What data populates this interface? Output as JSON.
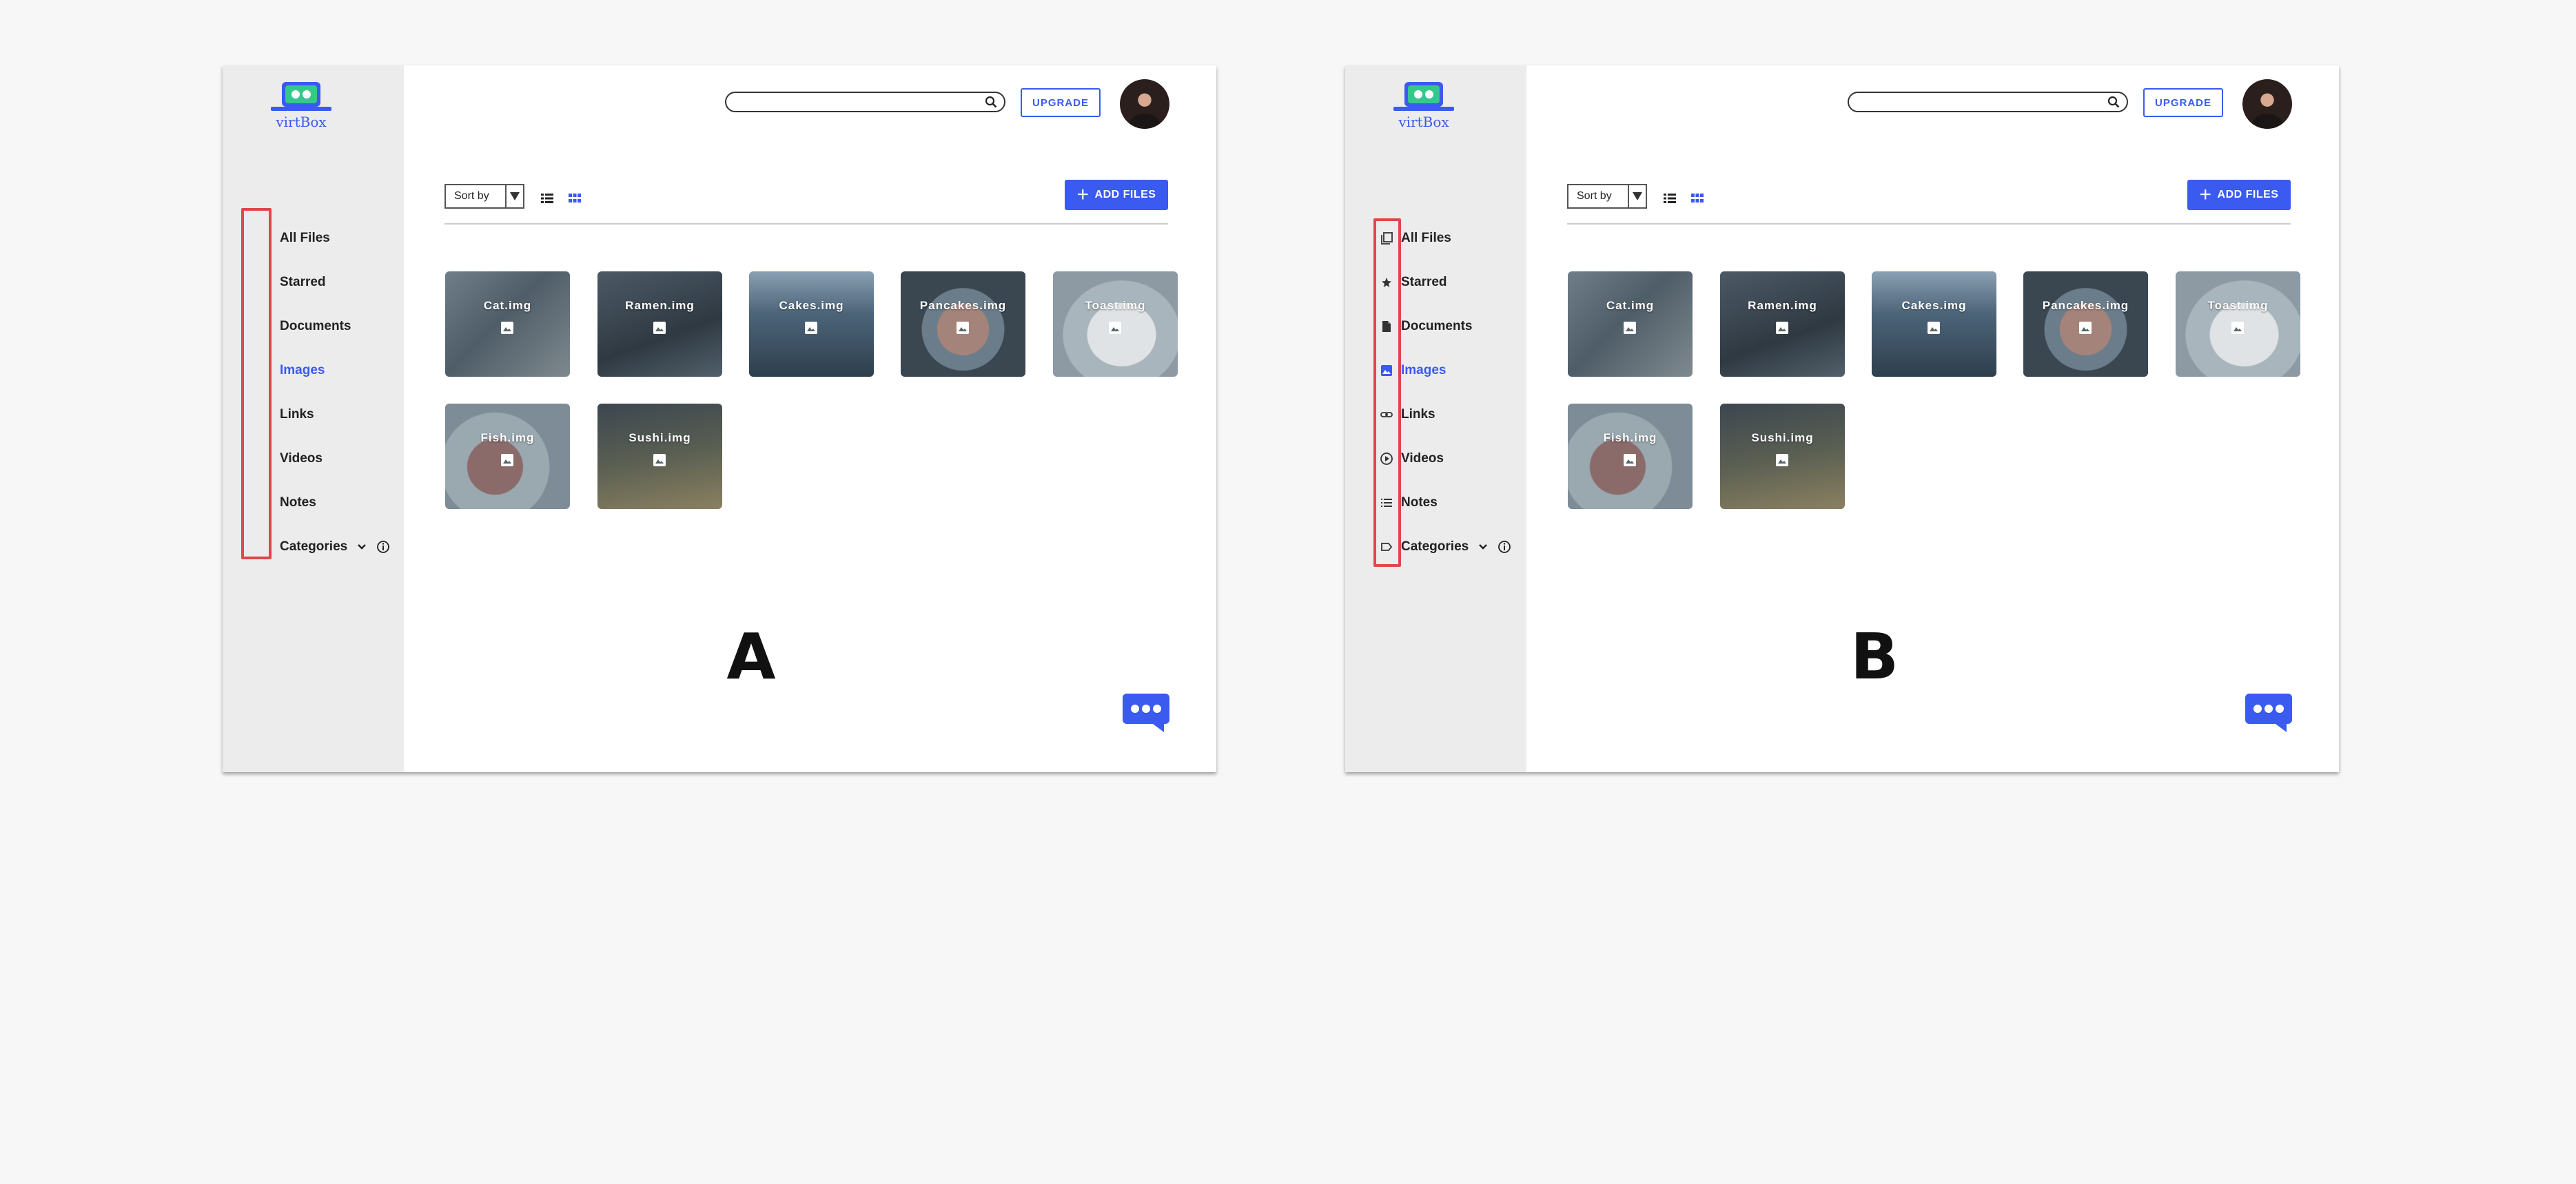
{
  "brand": {
    "name": "virtBox"
  },
  "colors": {
    "accent": "#3a5af0",
    "highlight": "#e0474c",
    "sidebar": "#ececec"
  },
  "search": {
    "placeholder": "",
    "value": ""
  },
  "upgrade_label": "UPGRADE",
  "sort_label": "Sort by",
  "add_files_label": "ADD FILES",
  "nav": {
    "items": [
      {
        "label": "All Files",
        "icon": "copy-icon"
      },
      {
        "label": "Starred",
        "icon": "star-icon"
      },
      {
        "label": "Documents",
        "icon": "document-icon"
      },
      {
        "label": "Images",
        "icon": "image-icon",
        "active": true
      },
      {
        "label": "Links",
        "icon": "link-icon"
      },
      {
        "label": "Videos",
        "icon": "play-circle-icon"
      },
      {
        "label": "Notes",
        "icon": "list-icon"
      },
      {
        "label": "Categories",
        "icon": "tag-icon"
      }
    ]
  },
  "files": [
    {
      "name": "Cat.img"
    },
    {
      "name": "Ramen.img"
    },
    {
      "name": "Cakes.img"
    },
    {
      "name": "Pancakes.img"
    },
    {
      "name": "Toast.img"
    },
    {
      "name": "Fish.img"
    },
    {
      "name": "Sushi.img"
    }
  ],
  "variants": [
    {
      "label": "A",
      "nav_icons": false
    },
    {
      "label": "B",
      "nav_icons": true
    }
  ]
}
